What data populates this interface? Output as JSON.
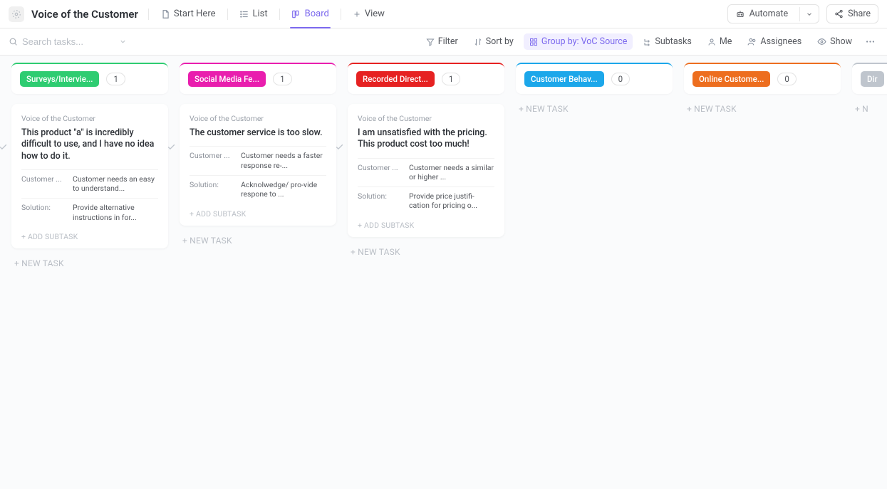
{
  "header": {
    "title": "Voice of the Customer",
    "tabs": [
      {
        "label": "Start Here"
      },
      {
        "label": "List"
      },
      {
        "label": "Board"
      },
      {
        "label": "View"
      }
    ],
    "automate": "Automate",
    "share": "Share"
  },
  "toolbar": {
    "search_placeholder": "Search tasks...",
    "filter": "Filter",
    "sort": "Sort by",
    "group": "Group by: VoC Source",
    "subtasks": "Subtasks",
    "me": "Me",
    "assignees": "Assignees",
    "show": "Show"
  },
  "board": {
    "add_subtask_label": "+ ADD SUBTASK",
    "new_task_label": "+ NEW TASK",
    "columns": [
      {
        "label": "Surveys/Intervie...",
        "count": "1",
        "color": "#2ecc71",
        "cards": [
          {
            "breadcrumb": "Voice of the Customer",
            "title": "This product \"a\" is incredibly difficult to use, and I have no idea how to do it.",
            "fields": [
              {
                "label": "Customer ...",
                "value": "Customer needs an easy to understand..."
              },
              {
                "label": "Solution:",
                "value": "Provide alternative instructions in for..."
              }
            ]
          }
        ]
      },
      {
        "label": "Social Media Fe...",
        "count": "1",
        "color": "#e91eae",
        "cards": [
          {
            "breadcrumb": "Voice of the Customer",
            "title": "The customer service is too slow.",
            "fields": [
              {
                "label": "Customer ...",
                "value": "Customer needs a faster response re-..."
              },
              {
                "label": "Solution:",
                "value": "Acknolwedge/ pro-vide respone to ..."
              }
            ]
          }
        ]
      },
      {
        "label": "Recorded Direct...",
        "count": "1",
        "color": "#e62222",
        "cards": [
          {
            "breadcrumb": "Voice of the Customer",
            "title": "I am unsatisfied with the pricing. This product cost too much!",
            "fields": [
              {
                "label": "Customer ...",
                "value": "Customer needs a similar or higher ..."
              },
              {
                "label": "Solution:",
                "value": "Provide price justifi-cation for pricing o..."
              }
            ]
          }
        ]
      },
      {
        "label": "Customer Behav...",
        "count": "0",
        "color": "#1ca7ea",
        "cards": []
      },
      {
        "label": "Online Custome...",
        "count": "0",
        "color": "#ed6e1f",
        "cards": []
      },
      {
        "label": "Dir",
        "count": "",
        "color": "#bfc5cd",
        "cards": []
      }
    ]
  }
}
